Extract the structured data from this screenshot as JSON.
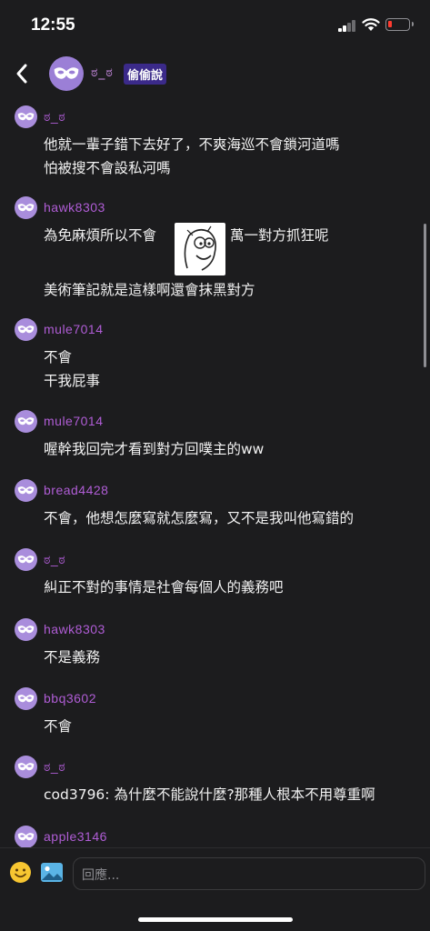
{
  "status_bar": {
    "time": "12:55"
  },
  "header": {
    "name": "ಠ_ಠ",
    "badge": "偷偷說"
  },
  "comments": [
    {
      "user": "ಠ_ಠ",
      "lines": [
        "他就一輩子錯下去好了，不爽海巡不會鎖河道嗎",
        "怕被搜不會設私河嗎"
      ]
    },
    {
      "user": "hawk8303",
      "line1_before": "為免麻煩所以不會",
      "line1_after": "萬一對方抓狂呢",
      "line2": "美術筆記就是這樣啊還會抹黑對方"
    },
    {
      "user": "mule7014",
      "lines": [
        "不會",
        "干我屁事"
      ]
    },
    {
      "user": "mule7014",
      "lines": [
        "喔幹我回完才看到對方回噗主的ww"
      ]
    },
    {
      "user": "bread4428",
      "lines": [
        "不會，他想怎麼寫就怎麼寫，又不是我叫他寫錯的"
      ]
    },
    {
      "user": "ಠ_ಠ",
      "lines": [
        "糾正不對的事情是社會每個人的義務吧"
      ]
    },
    {
      "user": "hawk8303",
      "lines": [
        "不是義務"
      ]
    },
    {
      "user": "bbq3602",
      "lines": [
        "不會"
      ]
    },
    {
      "user": "ಠ_ಠ",
      "lines": [
        "cod3796: 為什麼不能說什麼?那種人根本不用尊重啊"
      ]
    },
    {
      "user": "apple3146",
      "lines": []
    }
  ],
  "reply_placeholder": "回應...",
  "colors": {
    "background": "#1c1c1e",
    "username": "#b05dd6",
    "avatar": "#a98ddc",
    "badge": "#3b2a8a"
  },
  "icons": [
    "back-arrow-icon",
    "mask-avatar-icon",
    "emoji-icon",
    "image-icon",
    "cellular-signal-icon",
    "wifi-icon",
    "battery-icon"
  ]
}
